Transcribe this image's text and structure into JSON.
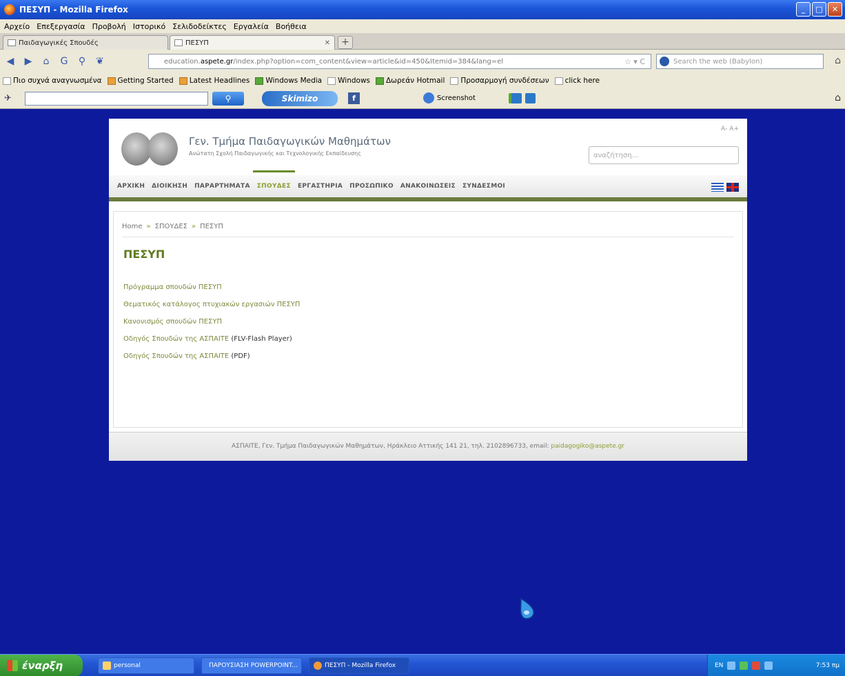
{
  "window": {
    "title": "ΠΕΣΥΠ - Mozilla Firefox",
    "controls": [
      "_",
      "□",
      "✕"
    ]
  },
  "menu": [
    "Αρχείο",
    "Επεξεργασία",
    "Προβολή",
    "Ιστορικό",
    "Σελιδοδείκτες",
    "Εργαλεία",
    "Βοήθεια"
  ],
  "tabs": [
    {
      "label": "Παιδαγωγικές Σπουδές"
    },
    {
      "label": "ΠΕΣΥΠ"
    }
  ],
  "newtab_label": "+",
  "url": {
    "prefix": "education.",
    "domain": "aspete.gr",
    "path": "/index.php?option=com_content&view=article&id=450&Itemid=384&lang=el"
  },
  "web_search_placeholder": "Search the web (Babylon)",
  "bookmarks": [
    "Πιο συχνά αναγνωσμένα",
    "Getting Started",
    "Latest Headlines",
    "Windows Media",
    "Windows",
    "Δωρεάν Hotmail",
    "Προσαρμογή συνδέσεων",
    "click here"
  ],
  "toolbar": {
    "brand": "Skimizo",
    "screenshot_label": "Screenshot"
  },
  "site": {
    "title": "Γεν. Τμήμα Παιδαγωγικών Μαθημάτων",
    "subtitle": "Ανώτατη Σχολή Παιδαγωγικής και Τεχνολογικής Εκπαίδευσης",
    "lang_small": "Α- Α+",
    "search_placeholder": "αναζήτηση...",
    "nav": [
      "ΑΡΧΙΚΗ",
      "ΔΙΟΙΚΗΣΗ",
      "ΠΑΡΑΡΤΗΜΑΤΑ",
      "ΣΠΟΥΔΕΣ",
      "ΕΡΓΑΣΤΗΡΙΑ",
      "ΠΡΟΣΩΠΙΚΟ",
      "ΑΝΑΚΟΙΝΩΣΕΙΣ",
      "ΣΥΝΔΕΣΜΟΙ"
    ],
    "nav_active": "ΣΠΟΥΔΕΣ",
    "breadcrumb": [
      "Home",
      "ΣΠΟΥΔΕΣ",
      "ΠΕΣΥΠ"
    ],
    "breadcrumb_sep": "»",
    "heading": "ΠΕΣΥΠ",
    "links": [
      {
        "text": "Πρόγραμμα σπουδών ΠΕΣΥΠ",
        "suffix": ""
      },
      {
        "text": "Θεματικός κατάλογος πτυχιακών εργασιών ΠΕΣΥΠ",
        "suffix": ""
      },
      {
        "text": "Κανονισμός σπουδών ΠΕΣΥΠ",
        "suffix": ""
      },
      {
        "text": "Οδηγός Σπουδών της ΑΣΠΑΙΤΕ",
        "suffix": "(FLV-Flash Player)"
      },
      {
        "text": "Οδηγός Σπουδών της ΑΣΠΑΙΤΕ",
        "suffix": "(PDF)"
      }
    ],
    "footer_text": "ΑΣΠΑΙΤΕ, Γεν. Τμήμα Παιδαγωγικών Μαθημάτων, Ηράκλειο Αττικής 141 21, τηλ. 2102896733, email:",
    "footer_email": "paidagogiko@aspete.gr"
  },
  "taskbar": {
    "start": "έναρξη",
    "items": [
      "personal",
      "ΠΑΡΟΥΣΙΑΣΗ POWERPOINT...",
      "ΠΕΣΥΠ - Mozilla Firefox"
    ],
    "tray_lang": "EN",
    "clock": "7:53 πμ"
  }
}
